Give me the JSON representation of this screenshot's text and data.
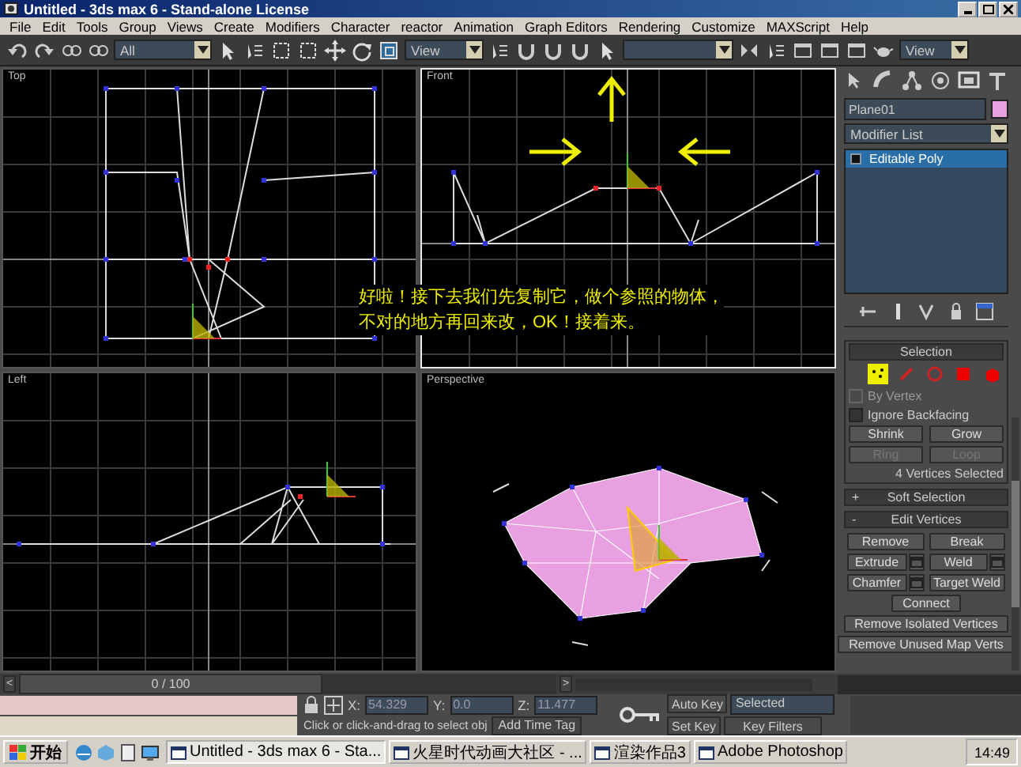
{
  "window": {
    "title": "Untitled - 3ds max 6 - Stand-alone License"
  },
  "menu": [
    "File",
    "Edit",
    "Tools",
    "Group",
    "Views",
    "Create",
    "Modifiers",
    "Character",
    "reactor",
    "Animation",
    "Graph Editors",
    "Rendering",
    "Customize",
    "MAXScript",
    "Help"
  ],
  "toolbar": {
    "selection_filter": "All",
    "reference_coord": "View",
    "render_type": "View"
  },
  "viewports": [
    {
      "label": "Top",
      "kind": "top",
      "selected": false
    },
    {
      "label": "Front",
      "kind": "front",
      "selected": true
    },
    {
      "label": "Left",
      "kind": "left",
      "selected": false
    },
    {
      "label": "Perspective",
      "kind": "perspective",
      "selected": false
    }
  ],
  "overlay_note": [
    "好啦！接下去我们先复制它，做个参照的物体，",
    "不对的地方再回来改，OK！接着来。"
  ],
  "command_panel": {
    "object_name": "Plane01",
    "modifier_list": "Modifier List",
    "stack": [
      {
        "label": "Editable Poly",
        "selected": true
      }
    ]
  },
  "selection": {
    "title": "Selection",
    "levels": [
      {
        "selected": true
      },
      {
        "selected": false
      },
      {
        "selected": false
      },
      {
        "selected": false
      },
      {
        "selected": false
      }
    ],
    "options": [
      {
        "label": "By Vertex",
        "checked": false,
        "disabled": true
      },
      {
        "label": "Ignore Backfacing",
        "checked": false,
        "disabled": false
      }
    ],
    "buttons": [
      {
        "label": "Shrink",
        "disabled": false
      },
      {
        "label": "Grow",
        "disabled": false
      },
      {
        "label": "Ring",
        "disabled": true
      },
      {
        "label": "Loop",
        "disabled": true
      }
    ],
    "info": "4 Vertices Selected"
  },
  "rollouts": [
    {
      "sign": "+",
      "title": "Soft Selection"
    },
    {
      "sign": "-",
      "title": "Edit Vertices",
      "buttons": [
        [
          {
            "label": "Remove",
            "settings": false
          },
          {
            "label": "Break",
            "settings": false
          }
        ],
        [
          {
            "label": "Extrude",
            "settings": true
          },
          {
            "label": "Weld",
            "settings": true
          }
        ],
        [
          {
            "label": "Chamfer",
            "settings": true
          },
          {
            "label": "Target Weld",
            "settings": false
          }
        ],
        [
          {
            "label": "Connect",
            "settings": false
          }
        ],
        [
          {
            "label": "Remove Isolated Vertices",
            "settings": false
          }
        ],
        [
          {
            "label": "Remove Unused Map Verts",
            "settings": false
          }
        ]
      ]
    }
  ],
  "time_slider": {
    "prev": "<",
    "position": "0 / 100",
    "next": ">",
    "level": 0
  },
  "coordinates": [
    {
      "axis": "X:",
      "value": "54.329"
    },
    {
      "axis": "Y:",
      "value": "0.0"
    },
    {
      "axis": "Z:",
      "value": "11.477"
    }
  ],
  "prompt": "Click or click-and-drag to select obj",
  "add_time_tag": "Add Time Tag",
  "animation": {
    "auto_key": "Auto Key",
    "set_key": "Set Key",
    "key_mode": "Selected",
    "key_filters": "Key Filters"
  },
  "taskbar": {
    "start": "开始",
    "tasks": [
      {
        "label": "Untitled - 3ds max 6 - Sta...",
        "selected": true
      },
      {
        "label": "火星时代动画大社区 - ...",
        "selected": false
      },
      {
        "label": "渲染作品3",
        "selected": false
      },
      {
        "label": "Adobe Photoshop",
        "selected": false
      }
    ],
    "clock": "14:49"
  }
}
